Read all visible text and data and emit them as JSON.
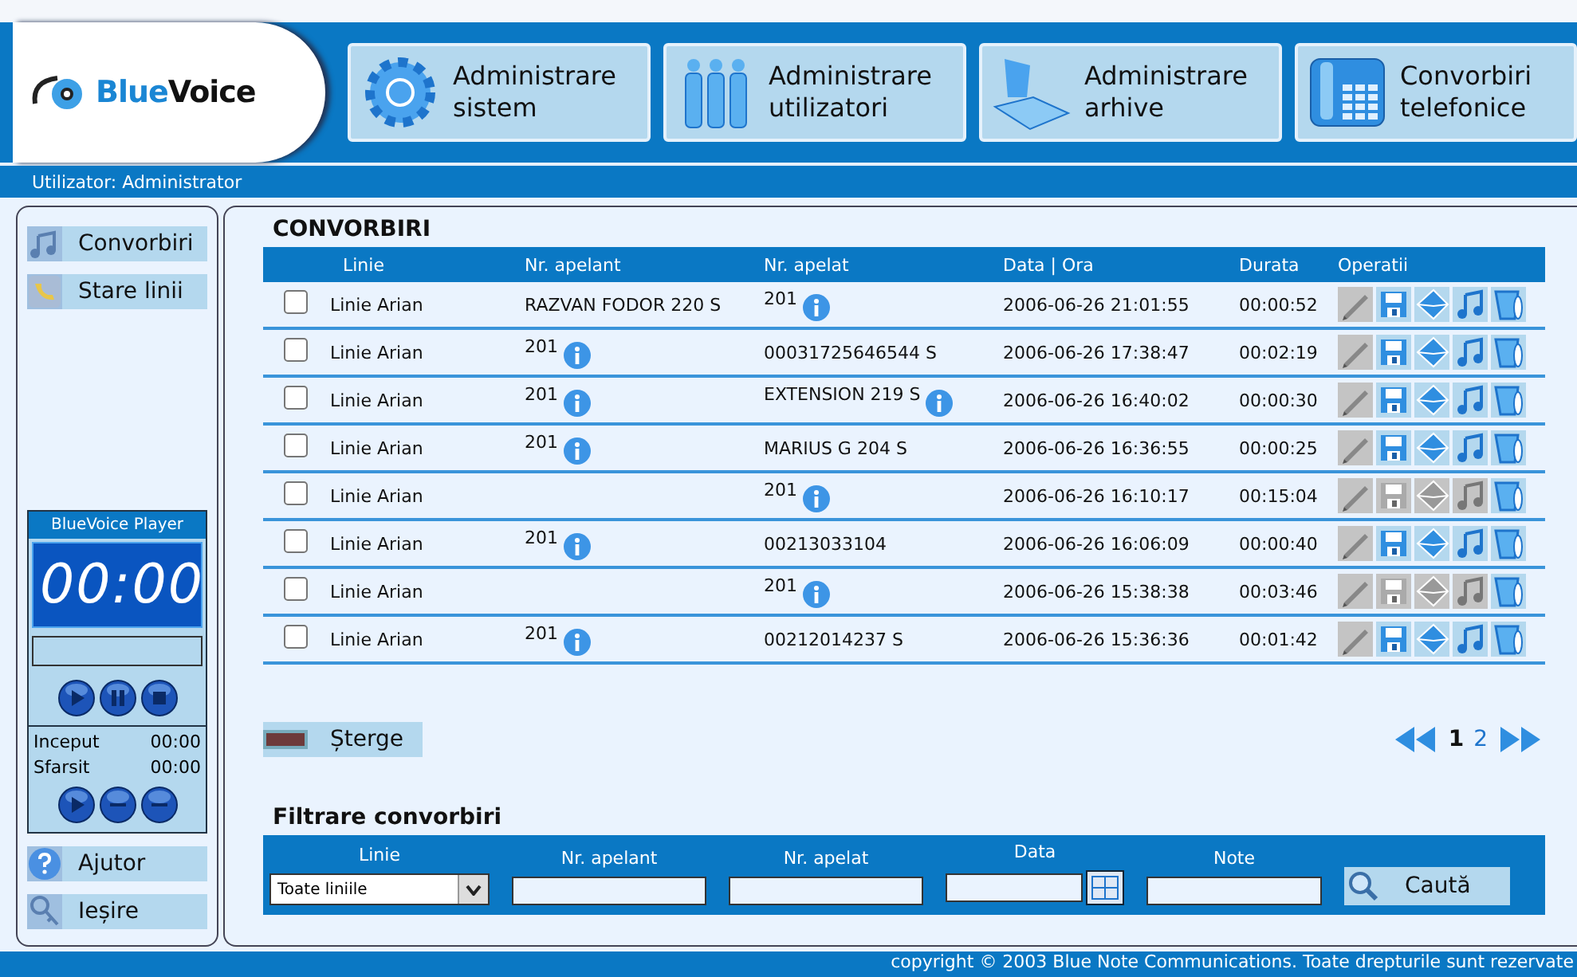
{
  "logo": {
    "text_blue": "Blue",
    "text_dark": "Voice"
  },
  "nav": [
    {
      "kind": "gear",
      "line1": "Administrare",
      "line2": "sistem"
    },
    {
      "kind": "people",
      "line1": "Administrare",
      "line2": "utilizatori"
    },
    {
      "kind": "archive",
      "line1": "Administrare",
      "line2": "arhive"
    },
    {
      "kind": "phone",
      "line1": "Convorbiri",
      "line2": "telefonice"
    }
  ],
  "user_bar": "Utilizator: Administrator",
  "sidebar": {
    "top_items": [
      {
        "kind": "music",
        "label": "Convorbiri"
      },
      {
        "kind": "phone",
        "label": "Stare linii"
      }
    ],
    "player": {
      "title": "BlueVoice Player",
      "time": "00:00",
      "level": 0,
      "start_label": "Inceput",
      "start_value": "00:00",
      "end_label": "Sfarsit",
      "end_value": "00:00"
    },
    "bottom_items": [
      {
        "kind": "help",
        "label": "Ajutor"
      },
      {
        "kind": "key",
        "label": "Ieșire"
      }
    ]
  },
  "section_title": "CONVORBIRI",
  "table": {
    "columns": [
      "Linie",
      "Nr. apelant",
      "Nr. apelat",
      "Data | Ora",
      "Durata",
      "Operatii"
    ],
    "rows": [
      {
        "checked": false,
        "line": "Linie Arian",
        "caller": {
          "text": "RAZVAN FODOR 220 S",
          "info": false
        },
        "called": {
          "text": "201",
          "info": true
        },
        "datetime": "2006-06-26 21:01:55",
        "duration": "00:00:52",
        "ops": [
          {
            "kind": "edit",
            "disabled": true
          },
          {
            "kind": "save",
            "disabled": false
          },
          {
            "kind": "mail",
            "disabled": false
          },
          {
            "kind": "music",
            "disabled": false
          },
          {
            "kind": "trash",
            "disabled": false
          }
        ]
      },
      {
        "checked": false,
        "line": "Linie Arian",
        "caller": {
          "text": "201",
          "info": true
        },
        "called": {
          "text": "00031725646544 S",
          "info": false
        },
        "datetime": "2006-06-26 17:38:47",
        "duration": "00:02:19",
        "ops": [
          {
            "kind": "edit",
            "disabled": true
          },
          {
            "kind": "save",
            "disabled": false
          },
          {
            "kind": "mail",
            "disabled": false
          },
          {
            "kind": "music",
            "disabled": false
          },
          {
            "kind": "trash",
            "disabled": false
          }
        ]
      },
      {
        "checked": false,
        "line": "Linie Arian",
        "caller": {
          "text": "201",
          "info": true
        },
        "called": {
          "text": "EXTENSION 219 S",
          "info": true
        },
        "datetime": "2006-06-26 16:40:02",
        "duration": "00:00:30",
        "ops": [
          {
            "kind": "edit",
            "disabled": true
          },
          {
            "kind": "save",
            "disabled": false
          },
          {
            "kind": "mail",
            "disabled": false
          },
          {
            "kind": "music",
            "disabled": false
          },
          {
            "kind": "trash",
            "disabled": false
          }
        ]
      },
      {
        "checked": false,
        "line": "Linie Arian",
        "caller": {
          "text": "201",
          "info": true
        },
        "called": {
          "text": "MARIUS G 204 S",
          "info": false
        },
        "datetime": "2006-06-26 16:36:55",
        "duration": "00:00:25",
        "ops": [
          {
            "kind": "edit",
            "disabled": true
          },
          {
            "kind": "save",
            "disabled": false
          },
          {
            "kind": "mail",
            "disabled": false
          },
          {
            "kind": "music",
            "disabled": false
          },
          {
            "kind": "trash",
            "disabled": false
          }
        ]
      },
      {
        "checked": false,
        "line": "Linie Arian",
        "called": {
          "text": "201",
          "info": true
        },
        "datetime": "2006-06-26 16:10:17",
        "duration": "00:15:04",
        "ops": [
          {
            "kind": "edit",
            "disabled": true
          },
          {
            "kind": "save",
            "disabled": true
          },
          {
            "kind": "mail",
            "disabled": true
          },
          {
            "kind": "music",
            "disabled": true
          },
          {
            "kind": "trash",
            "disabled": false
          }
        ]
      },
      {
        "checked": false,
        "line": "Linie Arian",
        "caller": {
          "text": "201",
          "info": true
        },
        "called": {
          "text": "00213033104",
          "info": false
        },
        "datetime": "2006-06-26 16:06:09",
        "duration": "00:00:40",
        "ops": [
          {
            "kind": "edit",
            "disabled": true
          },
          {
            "kind": "save",
            "disabled": false
          },
          {
            "kind": "mail",
            "disabled": false
          },
          {
            "kind": "music",
            "disabled": false
          },
          {
            "kind": "trash",
            "disabled": false
          }
        ]
      },
      {
        "checked": false,
        "line": "Linie Arian",
        "called": {
          "text": "201",
          "info": true
        },
        "datetime": "2006-06-26 15:38:38",
        "duration": "00:03:46",
        "ops": [
          {
            "kind": "edit",
            "disabled": true
          },
          {
            "kind": "save",
            "disabled": true
          },
          {
            "kind": "mail",
            "disabled": true
          },
          {
            "kind": "music",
            "disabled": true
          },
          {
            "kind": "trash",
            "disabled": false
          }
        ]
      },
      {
        "checked": false,
        "line": "Linie Arian",
        "caller": {
          "text": "201",
          "info": true
        },
        "called": {
          "text": "00212014237 S",
          "info": false
        },
        "datetime": "2006-06-26 15:36:36",
        "duration": "00:01:42",
        "ops": [
          {
            "kind": "edit",
            "disabled": true
          },
          {
            "kind": "save",
            "disabled": false
          },
          {
            "kind": "mail",
            "disabled": false
          },
          {
            "kind": "music",
            "disabled": false
          },
          {
            "kind": "trash",
            "disabled": false
          }
        ]
      }
    ]
  },
  "delete_button": "Șterge",
  "pages": [
    {
      "label": "1",
      "selected": true
    },
    {
      "label": "2",
      "selected": false
    }
  ],
  "filter": {
    "title": "Filtrare convorbiri",
    "line_label": "Linie",
    "line_value": "Toate liniile",
    "caller_label": "Nr. apelant",
    "called_label": "Nr. apelat",
    "date_label": "Data",
    "notes_label": "Note",
    "search_button": "Caută"
  },
  "footer": "copyright © 2003 Blue Note Communications. Toate drepturile sunt rezervate"
}
